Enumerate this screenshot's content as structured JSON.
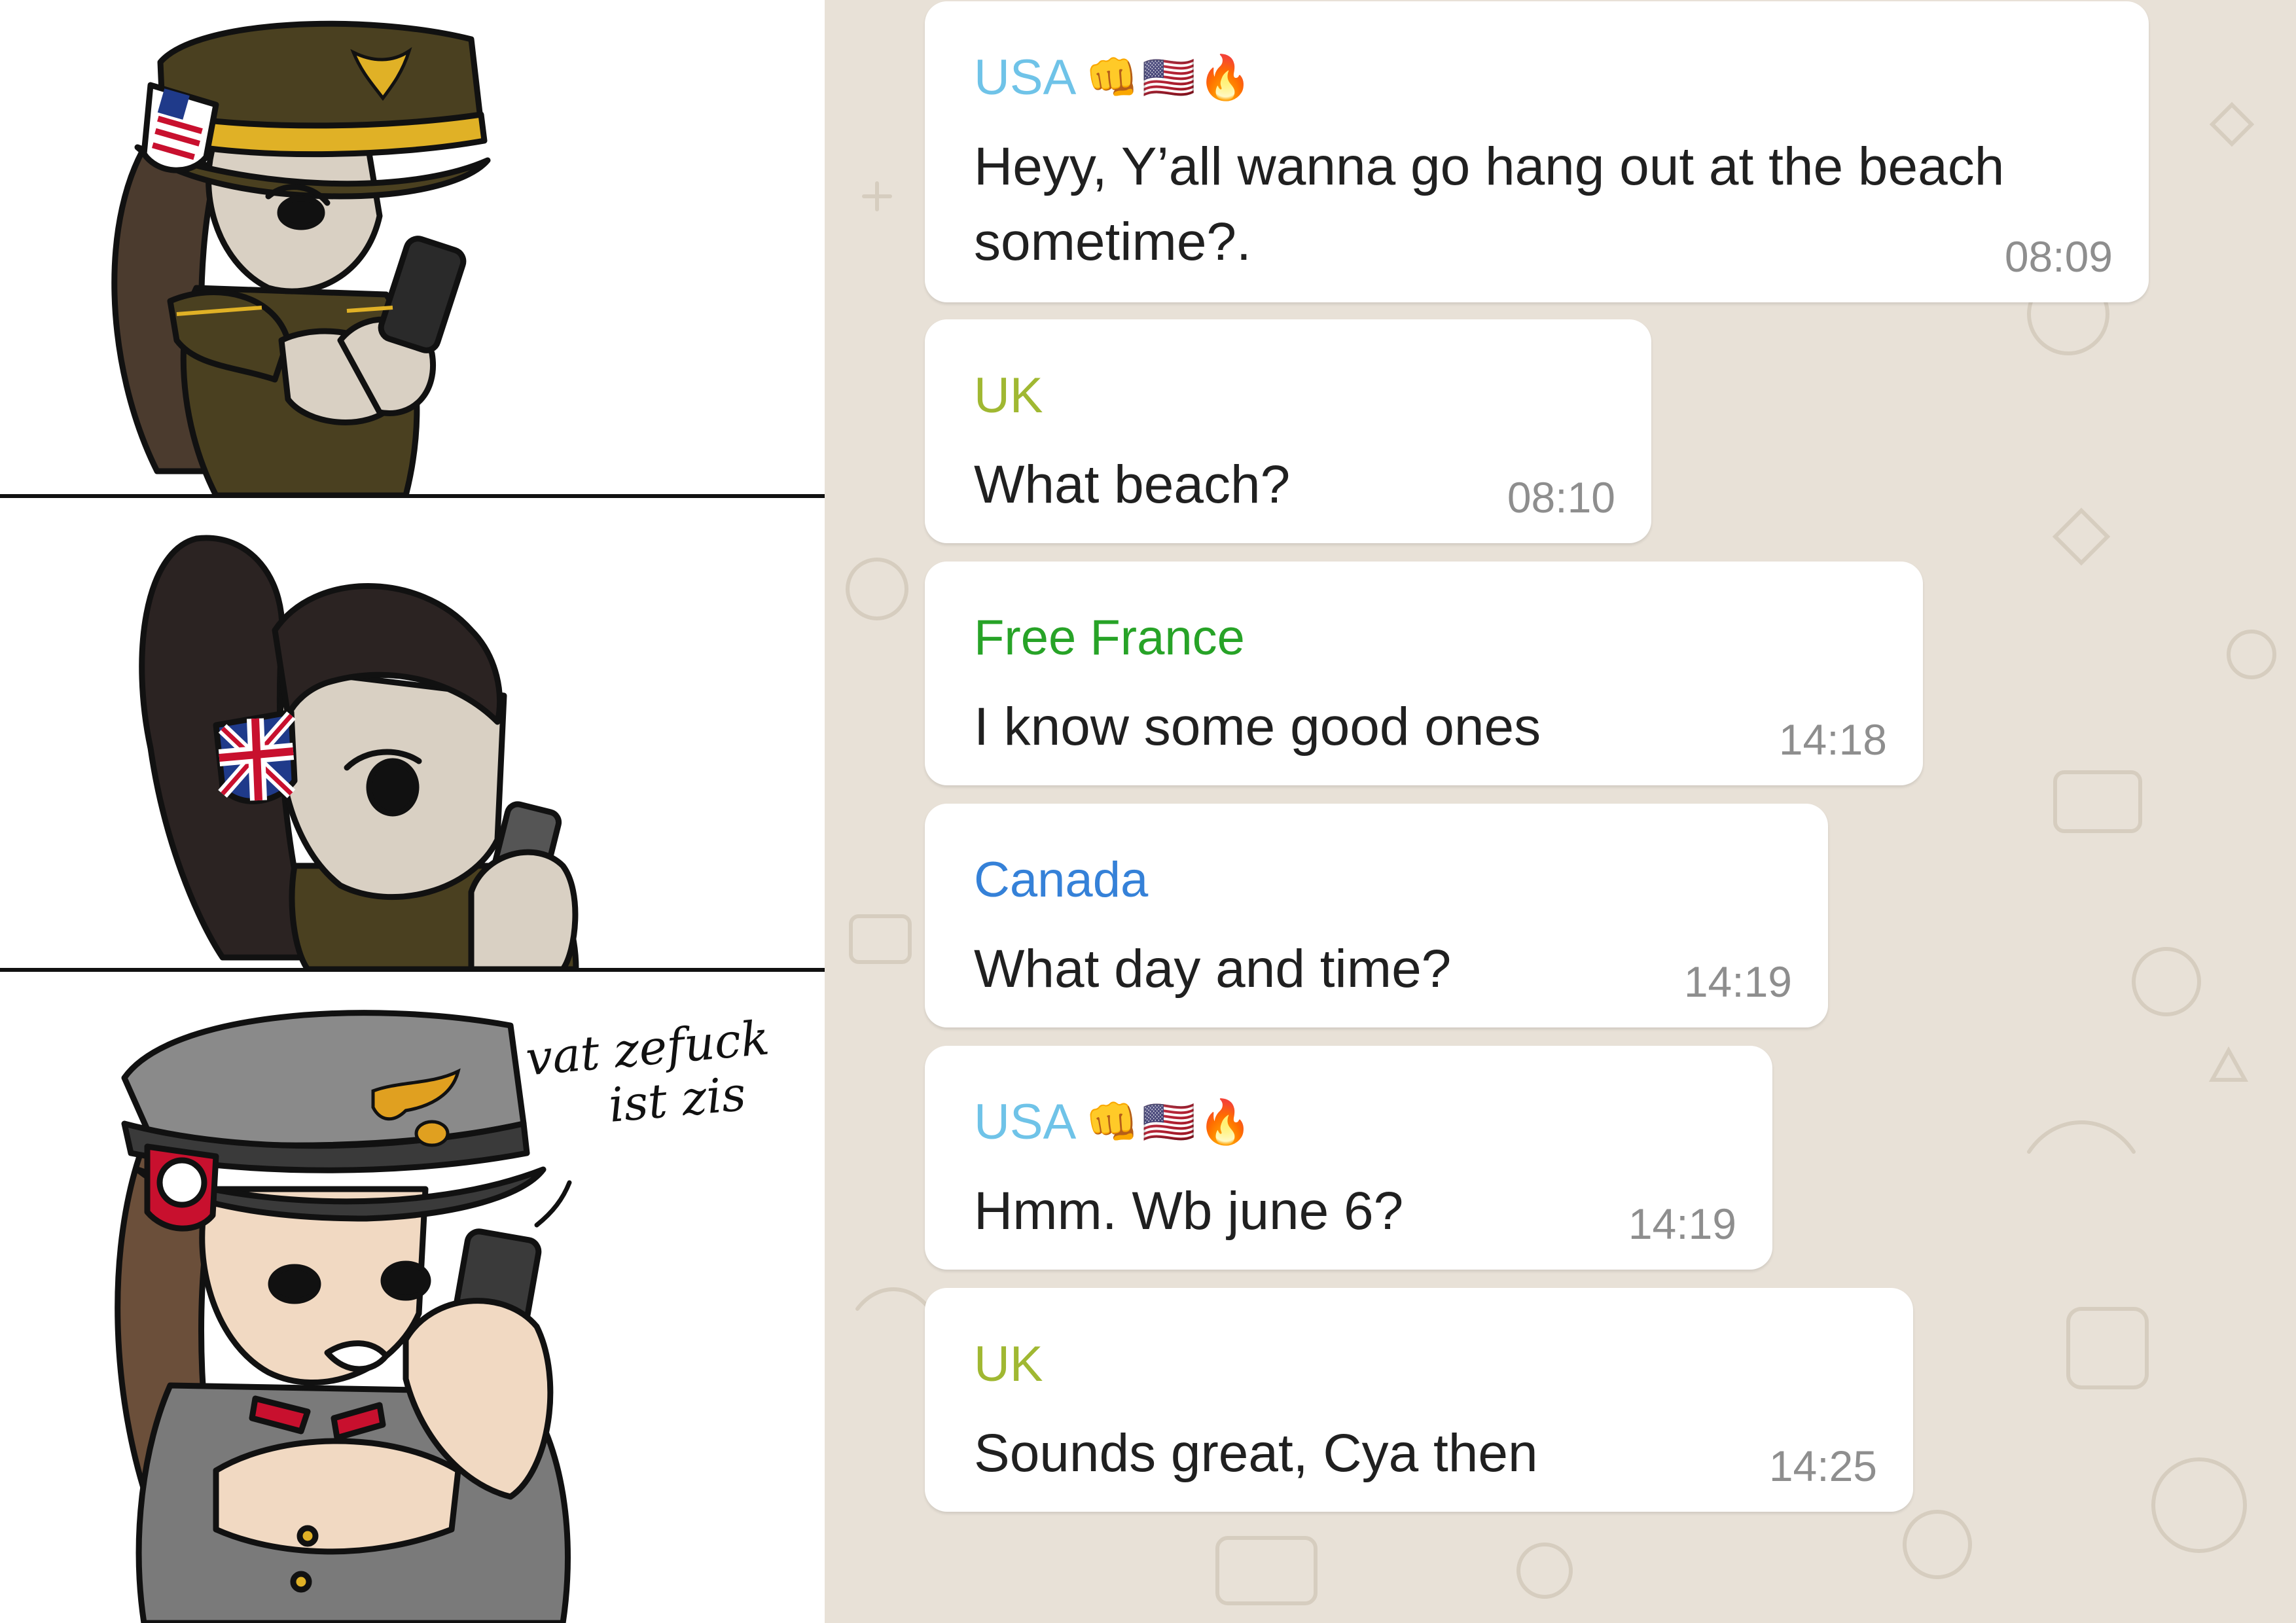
{
  "comic": {
    "speech_line1": "vat zefuck",
    "speech_line2": "ist zis"
  },
  "chat": {
    "messages": [
      {
        "sender": "USA",
        "emojis": "👊🇺🇸🔥",
        "text": "Heyy, Y’all wanna go hang out at the beach sometime?.",
        "time": "08:09"
      },
      {
        "sender": "UK",
        "emojis": "",
        "text": "What beach?",
        "time": "08:10"
      },
      {
        "sender": "Free France",
        "emojis": "",
        "text": "I know some good ones",
        "time": "14:18"
      },
      {
        "sender": "Canada",
        "emojis": "",
        "text": "What day and time?",
        "time": "14:19"
      },
      {
        "sender": "USA",
        "emojis": "👊🇺🇸🔥",
        "text": "Hmm. Wb june 6?",
        "time": "14:19"
      },
      {
        "sender": "UK",
        "emojis": "",
        "text": "Sounds great, Cya then",
        "time": "14:25"
      }
    ]
  },
  "colors": {
    "chat_background": "#e8e1d7",
    "usa_name": "#6fc3e8",
    "uk_name": "#a0b832",
    "free_france_name": "#27a327",
    "canada_name": "#3581d8",
    "timestamp": "#8e8e8e"
  }
}
